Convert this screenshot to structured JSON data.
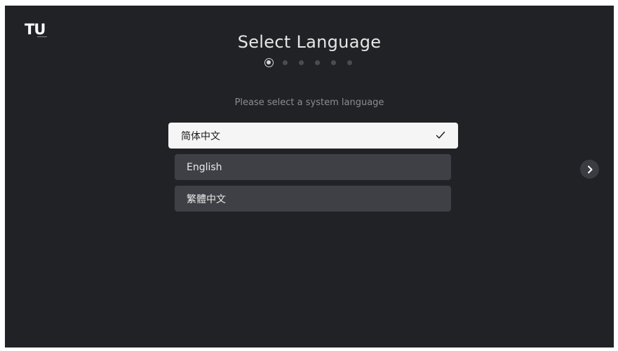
{
  "brand": {
    "logo_text": "TU"
  },
  "header": {
    "title": "Select Language"
  },
  "progress": {
    "total_steps": 6,
    "current_step": 1
  },
  "prompt": {
    "text": "Please select a system language"
  },
  "languages": [
    {
      "label": "简体中文",
      "selected": true
    },
    {
      "label": "English",
      "selected": false
    },
    {
      "label": "繁體中文",
      "selected": false
    }
  ],
  "icons": {
    "selected_indicator": "check-icon",
    "next": "chevron-right-icon"
  },
  "colors": {
    "background": "#212226",
    "selected_item": "#f5f5f5",
    "item": "#3f4045",
    "next_button": "#3b3c41"
  }
}
